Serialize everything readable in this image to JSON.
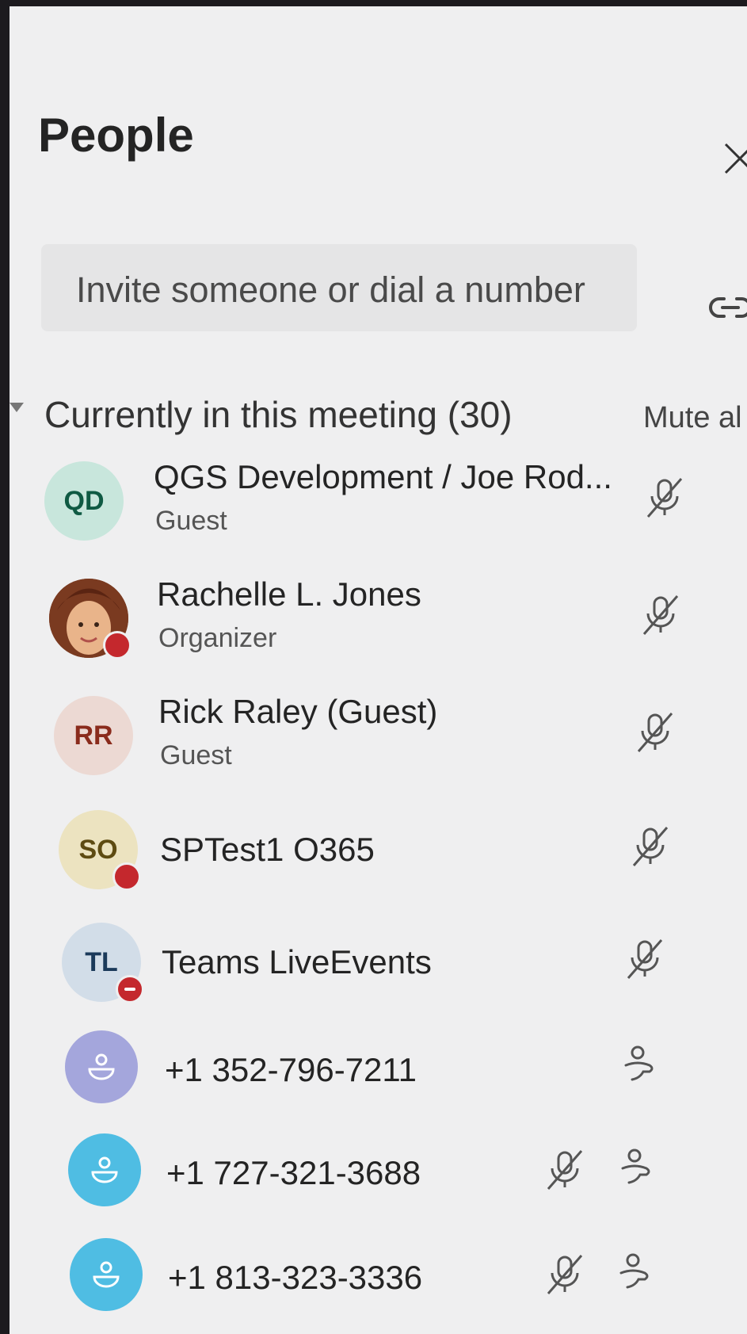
{
  "panel": {
    "title": "People",
    "invite_placeholder": "Invite someone or dial a number"
  },
  "section": {
    "title": "Currently in this meeting (30)",
    "mute_all_label": "Mute al"
  },
  "participants": [
    {
      "initials": "QD",
      "name": "QGS Development / Joe Rod...",
      "role": "Guest",
      "avatar_bg": "#c8e6dc",
      "avatar_fg": "#0f5a43",
      "status": "none",
      "mic": "muted",
      "phone": false
    },
    {
      "initials": "",
      "name": "Rachelle L. Jones",
      "role": "Organizer",
      "avatar_bg": "#7a3a20",
      "avatar_fg": "#ffffff",
      "status": "busy",
      "mic": "muted",
      "phone": false
    },
    {
      "initials": "RR",
      "name": "Rick Raley (Guest)",
      "role": "Guest",
      "avatar_bg": "#ecd9d3",
      "avatar_fg": "#8a2b1c",
      "status": "none",
      "mic": "muted",
      "phone": false
    },
    {
      "initials": "SO",
      "name": "SPTest1 O365",
      "role": "",
      "avatar_bg": "#ece3c0",
      "avatar_fg": "#5e4b12",
      "status": "busy",
      "mic": "muted",
      "phone": false
    },
    {
      "initials": "TL",
      "name": "Teams LiveEvents",
      "role": "",
      "avatar_bg": "#d2dde8",
      "avatar_fg": "#1b3a5a",
      "status": "dnd",
      "mic": "muted",
      "phone": false
    },
    {
      "initials": "",
      "name": "+1 352-796-7211",
      "role": "",
      "avatar_bg": "#a4a6dc",
      "avatar_fg": "#ffffff",
      "status": "none",
      "mic": "none",
      "phone": true
    },
    {
      "initials": "",
      "name": "+1 727-321-3688",
      "role": "",
      "avatar_bg": "#4fbde3",
      "avatar_fg": "#ffffff",
      "status": "none",
      "mic": "muted",
      "phone": true
    },
    {
      "initials": "",
      "name": "+1 813-323-3336",
      "role": "",
      "avatar_bg": "#4fbde3",
      "avatar_fg": "#ffffff",
      "status": "none",
      "mic": "muted",
      "phone": true
    }
  ],
  "colors": {
    "panel_bg": "#efeff0",
    "busy": "#c4282d",
    "text": "#242424"
  },
  "icons": [
    "close-icon",
    "link-icon",
    "caret-down-icon",
    "mic-off-icon",
    "phone-person-icon",
    "audio-caller-icon"
  ]
}
